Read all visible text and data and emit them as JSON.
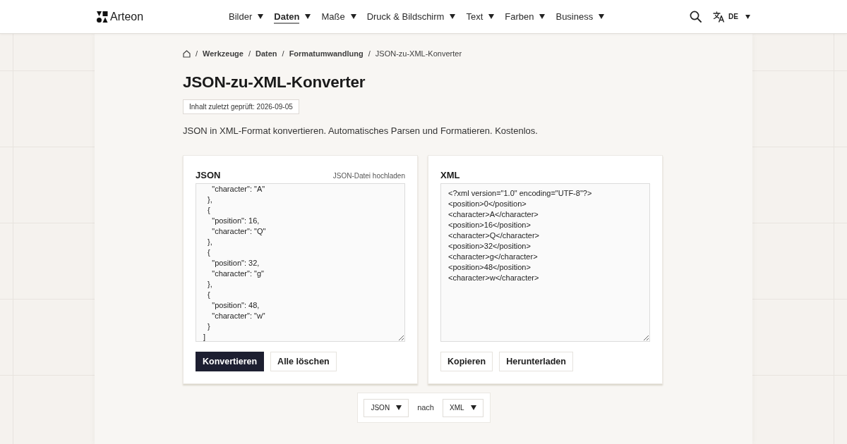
{
  "header": {
    "logo": "Arteon",
    "nav": [
      {
        "label": "Bilder",
        "selected": false
      },
      {
        "label": "Daten",
        "selected": true
      },
      {
        "label": "Maße",
        "selected": false
      },
      {
        "label": "Druck & Bildschirm",
        "selected": false
      },
      {
        "label": "Text",
        "selected": false
      },
      {
        "label": "Farben",
        "selected": false
      },
      {
        "label": "Business",
        "selected": false
      }
    ],
    "language": "DE"
  },
  "breadcrumb": {
    "separators": [
      "/",
      "/",
      "/",
      "/"
    ],
    "items": [
      {
        "label": "Werkzeuge",
        "current": false
      },
      {
        "label": "Daten",
        "current": false
      },
      {
        "label": "Formatumwandlung",
        "current": false
      },
      {
        "label": "JSON-zu-XML-Konverter",
        "current": true
      }
    ]
  },
  "title": "JSON-zu-XML-Konverter",
  "review_badge": "Inhalt zuletzt geprüft: 2026-09-05",
  "description": "JSON in XML-Format konvertieren. Automatisches Parsen und Formatieren. Kostenlos.",
  "panels": [
    {
      "label": "JSON",
      "upload_link": "JSON-Datei hochladen",
      "content": "    \"character\": \"A\"\n  },\n  {\n    \"position\": 16,\n    \"character\": \"Q\"\n  },\n  {\n    \"position\": 32,\n    \"character\": \"g\"\n  },\n  {\n    \"position\": 48,\n    \"character\": \"w\"\n  }\n]",
      "buttons": [
        {
          "label": "Konvertieren",
          "primary": true
        },
        {
          "label": "Alle löschen",
          "primary": false
        }
      ]
    },
    {
      "label": "XML",
      "content": "<?xml version=\"1.0\" encoding=\"UTF-8\"?>\n<position>0</position>\n<character>A</character>\n<position>16</position>\n<character>Q</character>\n<position>32</position>\n<character>g</character>\n<position>48</position>\n<character>w</character>",
      "buttons": [
        {
          "label": "Kopieren",
          "primary": false
        },
        {
          "label": "Herunterladen",
          "primary": false
        }
      ]
    }
  ],
  "format_bar": {
    "source": "JSON",
    "separator": "nach",
    "target": "XML"
  }
}
